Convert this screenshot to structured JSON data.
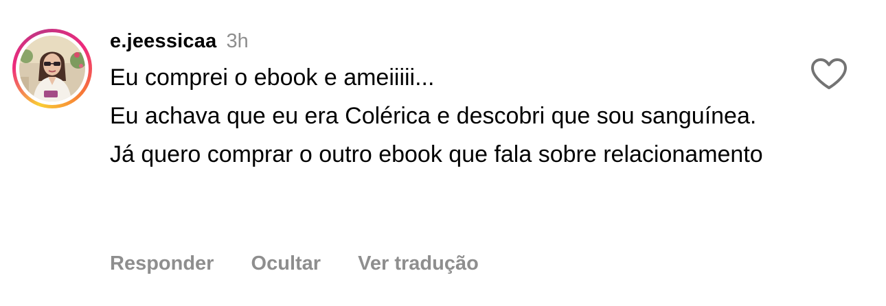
{
  "comment": {
    "username": "e.jeessicaa",
    "time": "3h",
    "paragraphs": [
      "Eu comprei o ebook e ameiiiii...",
      "Eu achava que eu era Colérica e descobri que sou sanguínea.",
      "Já quero comprar o outro ebook que fala sobre relacionamento"
    ],
    "actions": {
      "reply": "Responder",
      "hide": "Ocultar",
      "translate": "Ver tradução"
    },
    "like_icon": "heart-outline-icon"
  },
  "colors": {
    "text": "#000000",
    "muted": "#8e8e8e",
    "story_ring": [
      "#f9ce34",
      "#ee2a7b",
      "#c13584"
    ]
  }
}
